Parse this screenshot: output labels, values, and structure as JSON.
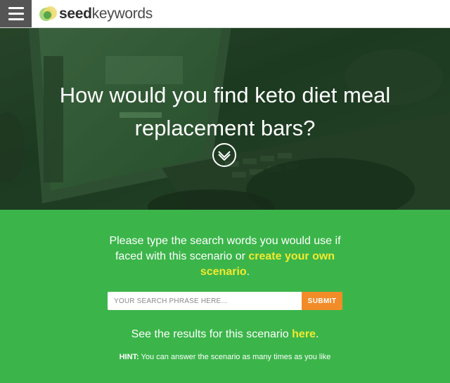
{
  "header": {
    "menu_icon": "hamburger-menu-icon",
    "logo_bold": "seed",
    "logo_light": "keywords"
  },
  "hero": {
    "title": "How would you find keto diet meal replacement bars?",
    "scroll_icon": "chevron-down-circle-icon"
  },
  "prompt": {
    "text_before": "Please type the search words you would use if faced with this scenario or ",
    "link": "create your own scenario",
    "text_after": "."
  },
  "search": {
    "placeholder": "YOUR SEARCH PHRASE HERE...",
    "value": "",
    "submit_label": "SUBMIT"
  },
  "results": {
    "text": "See the results for this scenario ",
    "link": "here",
    "after": "."
  },
  "hint": {
    "label": "HINT:",
    "text": " You can answer the scenario as many times as you like"
  },
  "colors": {
    "brand_green": "#3bb54a",
    "accent_yellow": "#f3ea2f",
    "submit_orange": "#f28c28",
    "menu_gray": "#555555"
  }
}
